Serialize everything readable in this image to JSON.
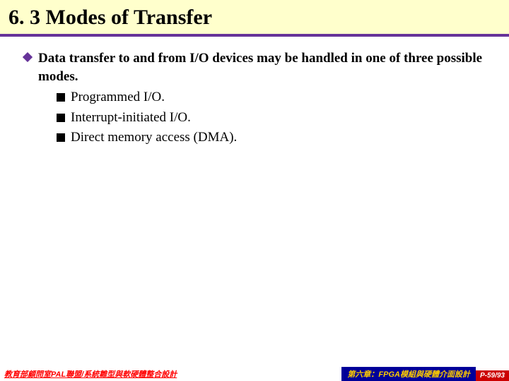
{
  "header": {
    "title": "6. 3 Modes of Transfer"
  },
  "main": {
    "bullet_text": "Data transfer to and from I/O devices may be handled in one of three possible modes.",
    "sub_bullets": [
      "Programmed I/O.",
      "Interrupt-initiated I/O.",
      "Direct memory access (DMA)."
    ]
  },
  "footer": {
    "left": "教育部顧問室PAL聯盟/系統雛型與軟硬體整合設計",
    "mid": "第六章：FPGA模組與硬體介面設計",
    "right": "P-59/93"
  }
}
